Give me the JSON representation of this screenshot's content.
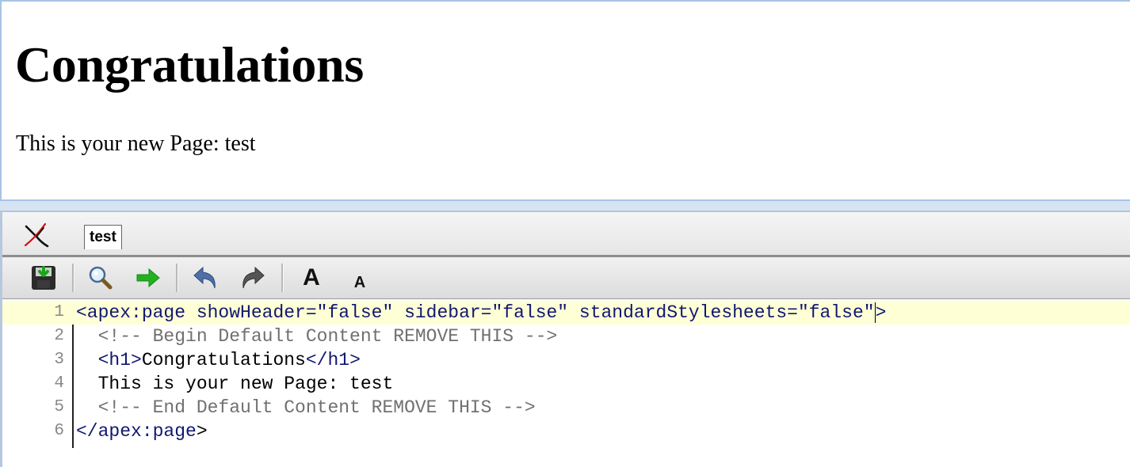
{
  "preview": {
    "heading": "Congratulations",
    "body": "This is your new Page: test"
  },
  "tabs": [
    {
      "label": "test",
      "active": true
    }
  ],
  "toolbar": {
    "buttons": [
      {
        "name": "save-icon"
      },
      {
        "name": "search-icon"
      },
      {
        "name": "go-to-line-icon"
      },
      {
        "name": "undo-icon"
      },
      {
        "name": "redo-icon"
      },
      {
        "name": "increase-font-icon",
        "glyph": "A"
      },
      {
        "name": "decrease-font-icon",
        "glyph": "A"
      }
    ]
  },
  "editor": {
    "lines": [
      {
        "num": "1",
        "parts": [
          {
            "t": "<apex:page showHeader=\"false\" sidebar=\"false\" standardStylesheets=\"false\"",
            "c": "tag"
          },
          {
            "t": ">",
            "c": "tag"
          }
        ]
      },
      {
        "num": "2",
        "parts": [
          {
            "t": "  <!-- Begin Default Content REMOVE THIS -->",
            "c": "cmt"
          }
        ]
      },
      {
        "num": "3",
        "parts": [
          {
            "t": "  ",
            "c": ""
          },
          {
            "t": "<h1>",
            "c": "tag"
          },
          {
            "t": "Congratulations",
            "c": ""
          },
          {
            "t": "</h1>",
            "c": "tag"
          }
        ]
      },
      {
        "num": "4",
        "parts": [
          {
            "t": "  This is your new Page: test",
            "c": ""
          }
        ]
      },
      {
        "num": "5",
        "parts": [
          {
            "t": "  <!-- End Default Content REMOVE THIS -->",
            "c": "cmt"
          }
        ]
      },
      {
        "num": "6",
        "parts": [
          {
            "t": "</apex:page",
            "c": "tag"
          },
          {
            "t": ">",
            "c": ""
          }
        ]
      }
    ]
  }
}
